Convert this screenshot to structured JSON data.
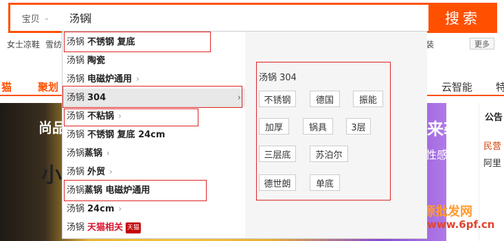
{
  "search": {
    "scope_label": "宝贝",
    "scope_chevron": "⌄",
    "query": "汤锅",
    "button_label": "搜索"
  },
  "hot_words": [
    "女士凉鞋",
    "雪纺"
  ],
  "hot_tail": "装",
  "more_label": "更多",
  "nav": {
    "item1": "猫",
    "item2": "聚划",
    "item3": "云智能",
    "item4": "特"
  },
  "banner": {
    "left_top": "尚品",
    "left_big": "小",
    "right_top": "来袭",
    "right_sub": "性感~"
  },
  "side": {
    "title": "公告",
    "red_link": "民营",
    "black_link": "阿里"
  },
  "watermark": {
    "text": "货源批发网",
    "url": "www.6pf.cn"
  },
  "suggestions": [
    {
      "prefix": "汤锅 ",
      "bold": "不锈钢 复底",
      "arrow": false
    },
    {
      "prefix": "汤锅 ",
      "bold": "陶瓷",
      "arrow": false
    },
    {
      "prefix": "汤锅 ",
      "bold": "电磁炉通用",
      "arrow": true
    },
    {
      "prefix": "汤锅 ",
      "bold": "304",
      "arrow": false,
      "active": true
    },
    {
      "prefix": "汤锅 ",
      "bold": "不粘锅",
      "arrow": true
    },
    {
      "prefix": "汤锅 ",
      "bold": "不锈钢 复底 24cm",
      "arrow": false
    },
    {
      "prefix": "汤锅",
      "bold": "蒸锅",
      "arrow": true
    },
    {
      "prefix": "汤锅 ",
      "bold": "外贸",
      "arrow": true
    },
    {
      "prefix": "汤锅",
      "bold": "蒸锅 电磁炉通用",
      "arrow": false
    },
    {
      "prefix": "汤锅 ",
      "bold": "24cm",
      "arrow": true
    },
    {
      "prefix": "汤锅 ",
      "bold": "天猫相关",
      "tmall": true,
      "badge": "天猫"
    }
  ],
  "panel": {
    "title": "汤锅 304",
    "tags": [
      "不锈钢",
      "德国",
      "振能",
      "加厚",
      "锅具",
      "3层",
      "三层底",
      "苏泊尔",
      "德世朗",
      "单底"
    ]
  },
  "icons": {
    "arrow_right": "›",
    "active_arrow": "›"
  },
  "colors": {
    "accent": "#ff5000",
    "highlight_box": "#dd2222"
  }
}
